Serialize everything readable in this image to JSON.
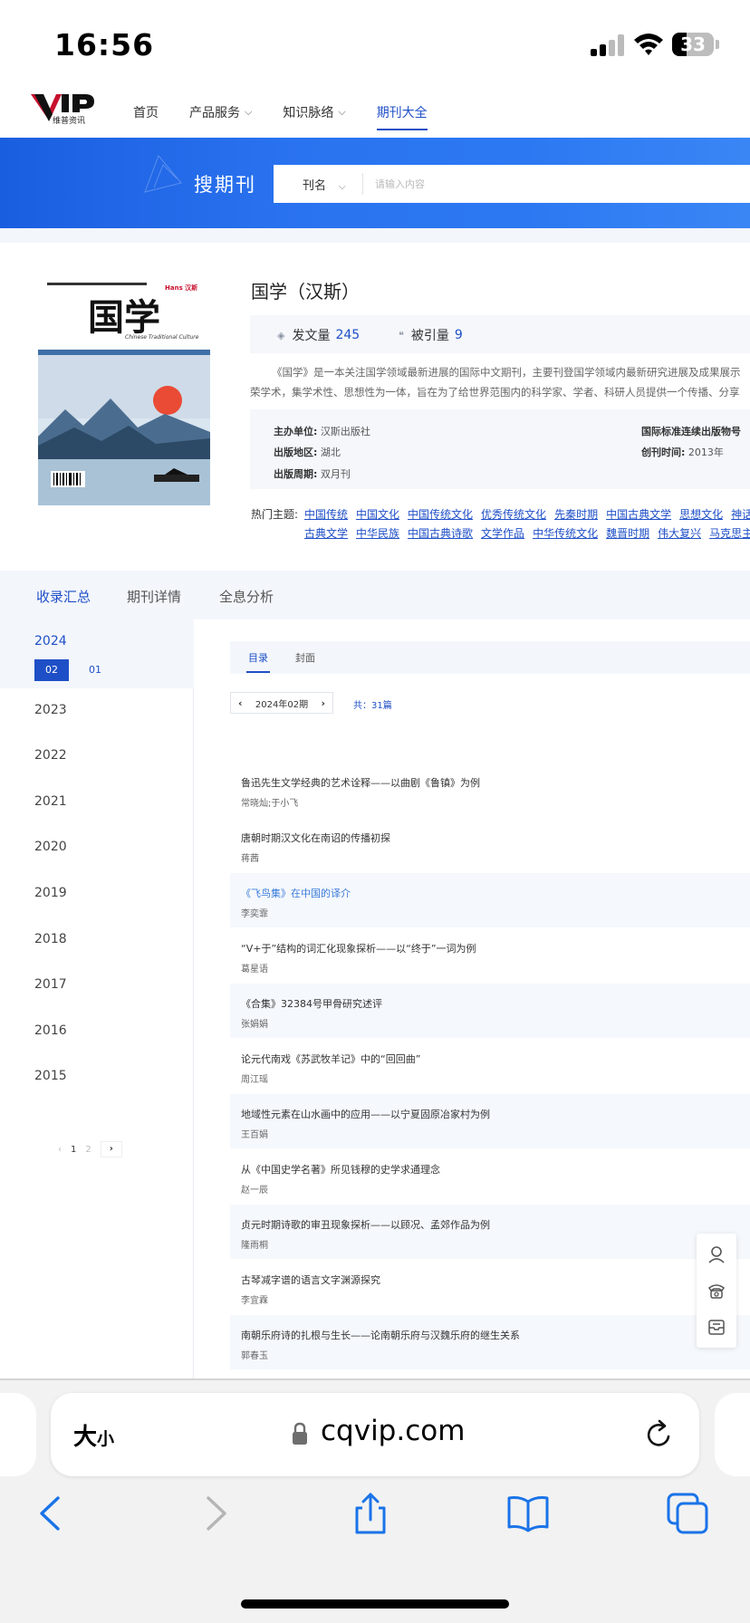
{
  "status": {
    "time": "16:56",
    "battery": "33"
  },
  "site": {
    "logo_sub": "维普资讯",
    "nav": [
      {
        "label": "首页",
        "chevron": false,
        "active": false
      },
      {
        "label": "产品服务",
        "chevron": true,
        "active": false
      },
      {
        "label": "知识脉络",
        "chevron": true,
        "active": false
      },
      {
        "label": "期刊大全",
        "chevron": false,
        "active": true
      }
    ]
  },
  "search": {
    "title": "搜期刊",
    "type_label": "刊名",
    "placeholder": "请输入内容"
  },
  "journal": {
    "title": "国学（汉斯）",
    "cover": {
      "title": "国学",
      "subtitle": "Chinese Traditional Culture",
      "publisher_mark": "Hans 汉斯"
    },
    "stats": {
      "articles_label": "发文量",
      "articles_value": "245",
      "citations_label": "被引量",
      "citations_value": "9"
    },
    "description_line1": "《国学》是一本关注国学领域最新进展的国际中文期刊，主要刊登国学领域内最新研究进展及成果展示",
    "description_line2": "荣学术，集学术性、思想性为一体，旨在为了给世界范围内的科学家、学者、科研人员提供一个传播、分享",
    "meta": {
      "sponsor_label": "主办单位:",
      "sponsor": "汉斯出版社",
      "region_label": "出版地区:",
      "region": "湖北",
      "cycle_label": "出版周期:",
      "cycle": "双月刊",
      "issn_label": "国际标准连续出版物号",
      "founded_label": "创刊时间:",
      "founded": "2013年"
    },
    "topics_label": "热门主题:",
    "topics_row1": [
      "中国传统",
      "中国文化",
      "中国传统文化",
      "优秀传统文化",
      "先秦时期",
      "中国古典文学",
      "思想文化",
      "神话传"
    ],
    "topics_row2": [
      "古典文学",
      "中华民族",
      "中国古典诗歌",
      "文学作品",
      "中华传统文化",
      "魏晋时期",
      "伟大复兴",
      "马克思主义"
    ]
  },
  "tabs": [
    "收录汇总",
    "期刊详情",
    "全息分析"
  ],
  "years": {
    "current": "2024",
    "issues": [
      "02",
      "01"
    ],
    "list": [
      "2023",
      "2022",
      "2021",
      "2020",
      "2019",
      "2018",
      "2017",
      "2016",
      "2015"
    ],
    "pager": {
      "prev": "‹",
      "pages": [
        "1",
        "2"
      ],
      "next": "›"
    }
  },
  "content": {
    "subtabs": [
      "目录",
      "封面"
    ],
    "issue_label": "2024年02期",
    "total": "共：31篇",
    "articles": [
      {
        "title": "鲁迅先生文学经典的艺术诠释——以曲剧《鲁镇》为例",
        "author": "常晓灿;于小飞",
        "shade": false,
        "highlight": false
      },
      {
        "title": "唐朝时期汉文化在南诏的传播初探",
        "author": "蒋茜",
        "shade": false,
        "highlight": false
      },
      {
        "title": "《飞鸟集》在中国的译介",
        "author": "李奕霏",
        "shade": true,
        "highlight": true
      },
      {
        "title": "“V+于”结构的词汇化现象探析——以“终于”一词为例",
        "author": "葛星语",
        "shade": false,
        "highlight": false
      },
      {
        "title": "《合集》32384号甲骨研究述评",
        "author": "张娟娟",
        "shade": true,
        "highlight": false
      },
      {
        "title": "论元代南戏《苏武牧羊记》中的“回回曲”",
        "author": "周江瑶",
        "shade": false,
        "highlight": false
      },
      {
        "title": "地域性元素在山水画中的应用——以宁夏固原冶家村为例",
        "author": "王百娟",
        "shade": true,
        "highlight": false
      },
      {
        "title": "从《中国史学名著》所见钱穆的史学求通理念",
        "author": "赵一辰",
        "shade": false,
        "highlight": false
      },
      {
        "title": "贞元时期诗歌的审丑现象探析——以顾况、孟郊作品为例",
        "author": "隆雨桐",
        "shade": true,
        "highlight": false
      },
      {
        "title": "古琴减字谱的语言文字渊源探究",
        "author": "李宜霖",
        "shade": false,
        "highlight": false
      },
      {
        "title": "南朝乐府诗的扎根与生长——论南朝乐府与汉魏乐府的继生关系",
        "author": "郭春玉",
        "shade": true,
        "highlight": false
      }
    ]
  },
  "safari": {
    "aa_big": "大",
    "aa_small": "小",
    "url": "cqvip.com"
  },
  "colors": {
    "accent": "#1f4fc7",
    "banner": "#2a73f0",
    "link": "#3a7bdc"
  }
}
